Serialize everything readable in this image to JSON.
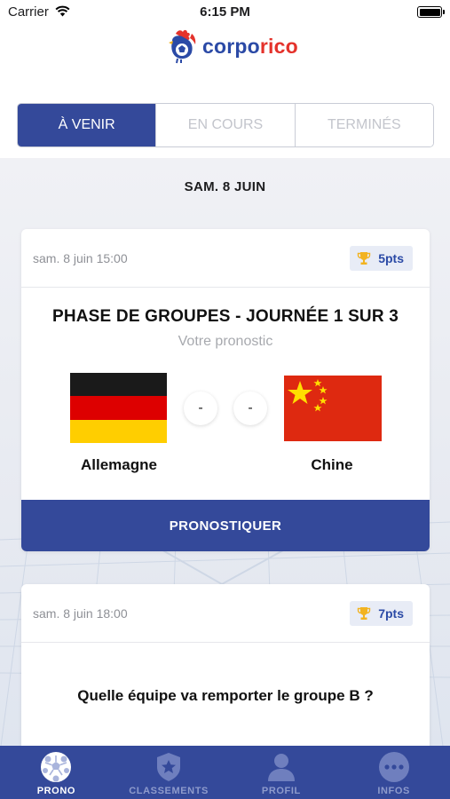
{
  "status_bar": {
    "carrier": "Carrier",
    "time": "6:15 PM"
  },
  "brand": {
    "name_a": "corpo",
    "name_b": "rico",
    "logo_icon": "rooster-icon"
  },
  "tabs": [
    {
      "label": "À VENIR",
      "active": true
    },
    {
      "label": "EN COURS",
      "active": false
    },
    {
      "label": "TERMINÉS",
      "active": false
    }
  ],
  "date_header": "SAM. 8 JUIN",
  "matches": [
    {
      "datetime": "sam. 8 juin 15:00",
      "points": "5pts",
      "phase": "PHASE DE GROUPES - JOURNÉE 1 SUR 3",
      "subtitle": "Votre pronostic",
      "home_team": "Allemagne",
      "away_team": "Chine",
      "home_score": "-",
      "away_score": "-",
      "home_flag": "germany-flag",
      "away_flag": "china-flag",
      "cta": "PRONOSTIQUER"
    },
    {
      "datetime": "sam. 8 juin 18:00",
      "points": "7pts",
      "question": "Quelle équipe va remporter le groupe B ?"
    }
  ],
  "nav": [
    {
      "label": "PRONO",
      "icon": "soccer-ball-icon",
      "active": true
    },
    {
      "label": "CLASSEMENTS",
      "icon": "star-badge-icon",
      "active": false
    },
    {
      "label": "PROFIL",
      "icon": "user-icon",
      "active": false
    },
    {
      "label": "INFOS",
      "icon": "more-icon",
      "active": false
    }
  ],
  "colors": {
    "primary": "#34499a",
    "accent_red": "#e4322b",
    "points_bg": "#e8ecf6"
  }
}
